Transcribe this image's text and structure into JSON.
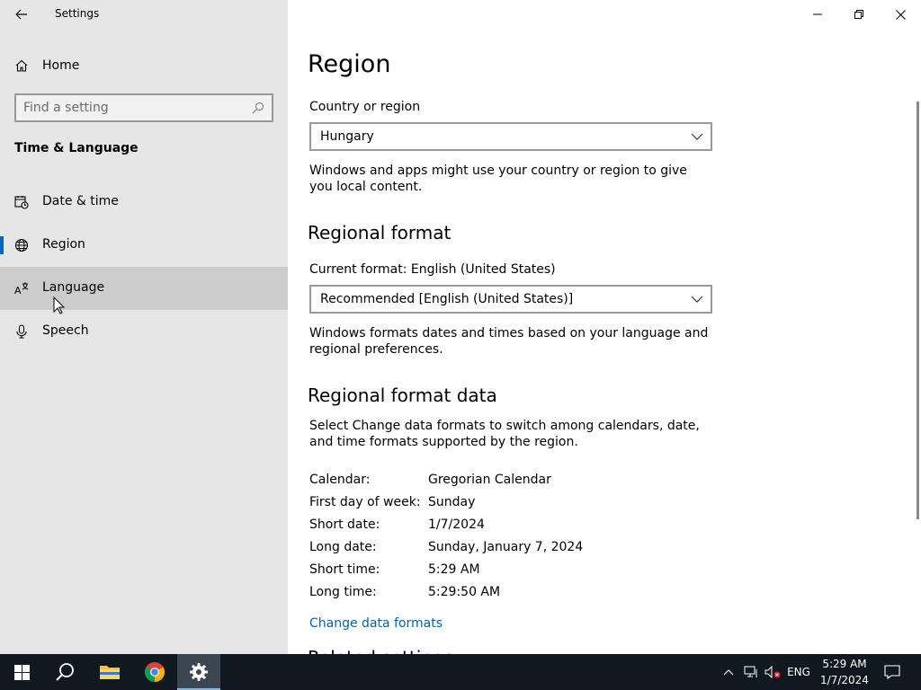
{
  "window": {
    "app_title": "Settings"
  },
  "sidebar": {
    "home_label": "Home",
    "search_placeholder": "Find a setting",
    "section_title": "Time & Language",
    "items": [
      {
        "label": "Date & time",
        "icon": "calendar-clock-icon"
      },
      {
        "label": "Region",
        "icon": "globe-icon",
        "selected": true
      },
      {
        "label": "Language",
        "icon": "language-icon",
        "hovered": true
      },
      {
        "label": "Speech",
        "icon": "microphone-icon"
      }
    ]
  },
  "main": {
    "title": "Region",
    "country_label": "Country or region",
    "country_value": "Hungary",
    "country_desc": "Windows and apps might use your country or region to give you local content.",
    "regional_format_heading": "Regional format",
    "current_format_label": "Current format: English (United States)",
    "format_value": "Recommended [English (United States)]",
    "format_desc": "Windows formats dates and times based on your language and regional preferences.",
    "format_data_heading": "Regional format data",
    "format_data_desc": "Select Change data formats to switch among calendars, date, and time formats supported by the region.",
    "format_data": [
      {
        "key": "Calendar:",
        "value": "Gregorian Calendar"
      },
      {
        "key": "First day of week:",
        "value": "Sunday"
      },
      {
        "key": "Short date:",
        "value": "1/7/2024"
      },
      {
        "key": "Long date:",
        "value": "Sunday, January 7, 2024"
      },
      {
        "key": "Short time:",
        "value": "5:29 AM"
      },
      {
        "key": "Long time:",
        "value": "5:29:50 AM"
      }
    ],
    "change_link": "Change data formats",
    "related_heading_partial": "Related settings"
  },
  "taskbar": {
    "language": "ENG",
    "time": "5:29 AM",
    "date": "1/7/2024"
  },
  "colors": {
    "accent": "#0067c0",
    "sidebar_bg": "#e6e6e6",
    "taskbar_bg": "#101820",
    "link": "#0063b1"
  }
}
